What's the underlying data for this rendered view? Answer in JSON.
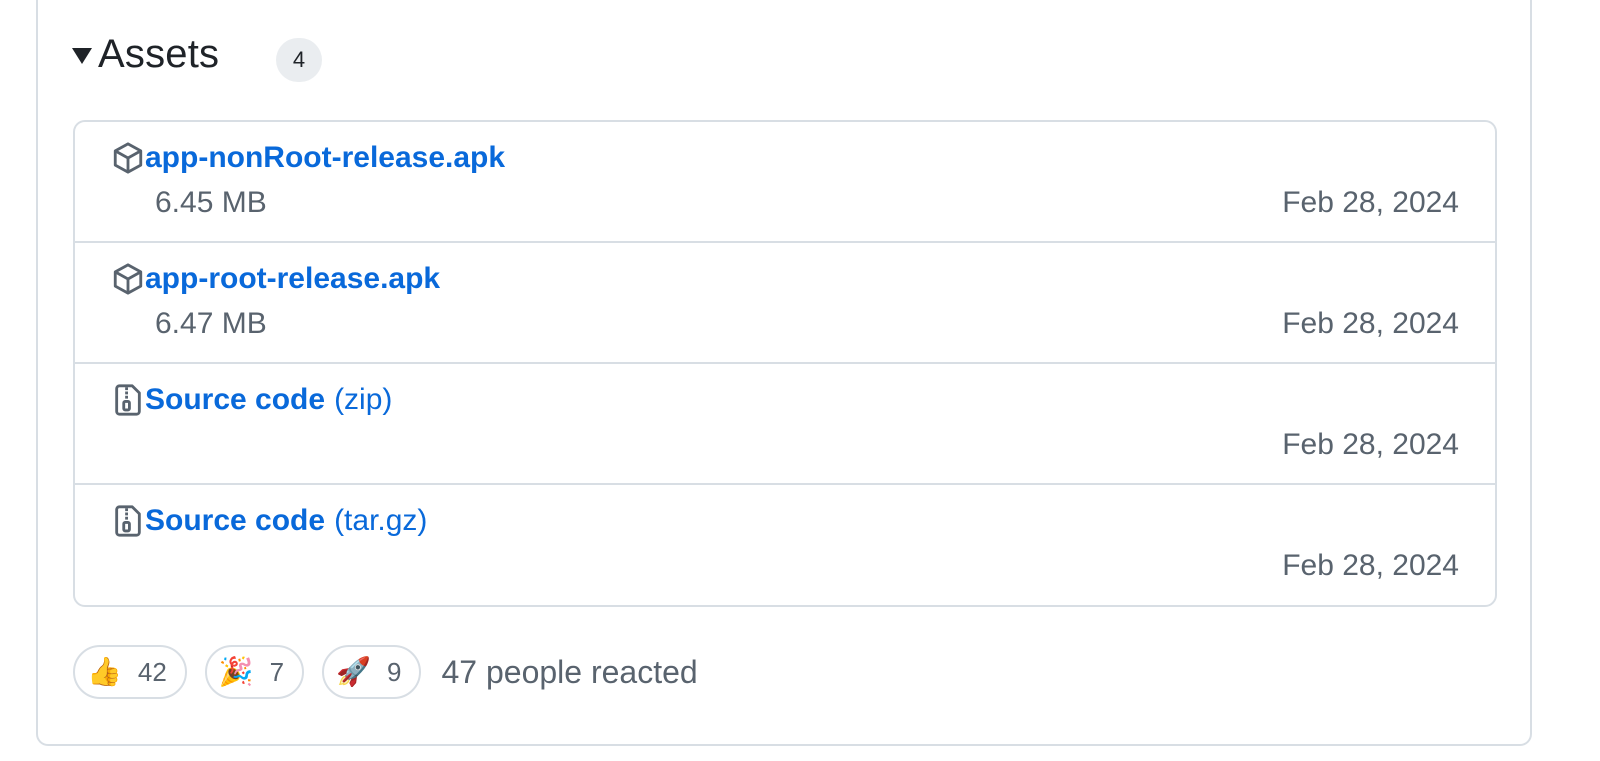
{
  "assets": {
    "title": "Assets",
    "count": "4",
    "items": [
      {
        "icon": "package-icon",
        "name": "app-nonRoot-release.apk",
        "suffix": "",
        "size": "6.45 MB",
        "date": "Feb 28, 2024"
      },
      {
        "icon": "package-icon",
        "name": "app-root-release.apk",
        "suffix": "",
        "size": "6.47 MB",
        "date": "Feb 28, 2024"
      },
      {
        "icon": "file-zip-icon",
        "name": "Source code",
        "suffix": "(zip)",
        "size": "",
        "date": "Feb 28, 2024"
      },
      {
        "icon": "file-zip-icon",
        "name": "Source code",
        "suffix": "(tar.gz)",
        "size": "",
        "date": "Feb 28, 2024"
      }
    ]
  },
  "reactions": {
    "items": [
      {
        "emoji": "👍",
        "icon": "thumbs-up-icon",
        "count": "42"
      },
      {
        "emoji": "🎉",
        "icon": "party-popper-icon",
        "count": "7"
      },
      {
        "emoji": "🚀",
        "icon": "rocket-icon",
        "count": "9"
      }
    ],
    "summary": "47 people reacted"
  },
  "colors": {
    "link": "#0969da",
    "muted": "#59636e",
    "border": "#d8dee4"
  }
}
